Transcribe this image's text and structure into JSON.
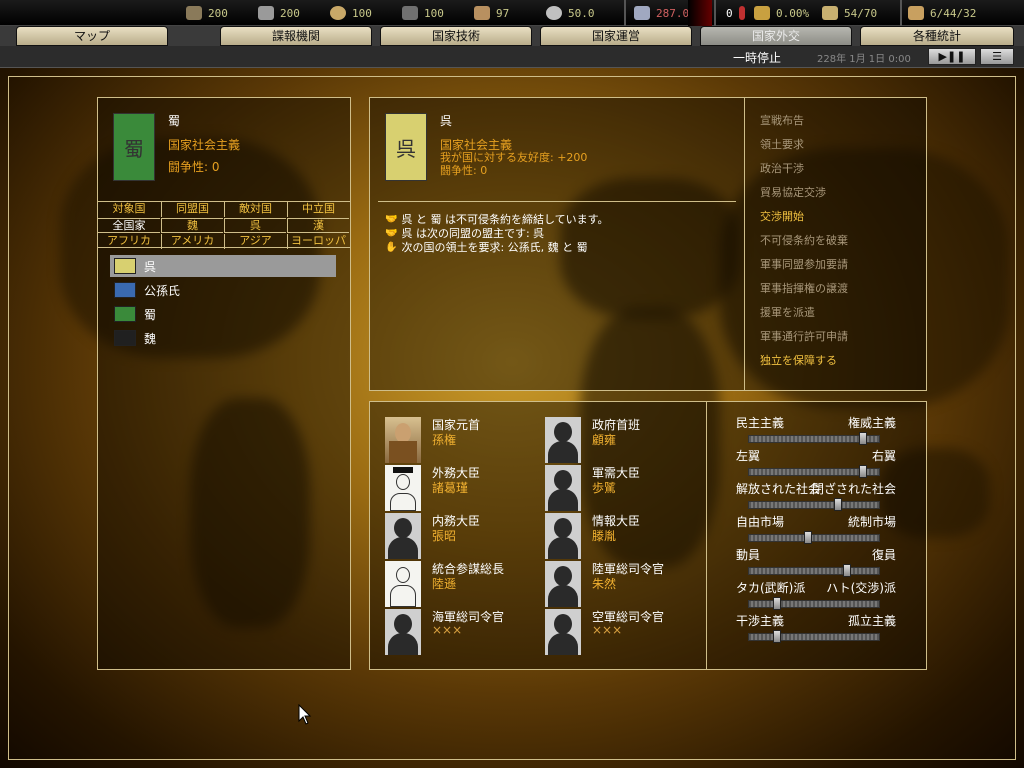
{
  "resources": [
    {
      "icon": "energy-icon",
      "value": "200",
      "color": "#8a7a5a"
    },
    {
      "icon": "metal-icon",
      "value": "200",
      "color": "#9a9a9a"
    },
    {
      "icon": "rare-materials-icon",
      "value": "100",
      "color": "#c8a868"
    },
    {
      "icon": "oil-icon",
      "value": "100",
      "color": "#707070"
    },
    {
      "icon": "supplies-icon",
      "value": "97",
      "color": "#b89060"
    },
    {
      "icon": "money-icon",
      "value": "50.0",
      "color": "#c0c0c0"
    },
    {
      "icon": "manpower-icon",
      "value": "287.0",
      "color": "#a0a8c0"
    },
    {
      "icon": "transport-icon",
      "value": "0",
      "color": "#c03030"
    },
    {
      "icon": "dissent-icon",
      "value": "0.00%",
      "color": "#c8a040"
    },
    {
      "icon": "convoy-icon",
      "value": "54/70",
      "color": "#c8b070"
    },
    {
      "icon": "escort-icon",
      "value": "6/44/32",
      "color": "#c8a060"
    }
  ],
  "tabs": [
    "マップ",
    "諜報機関",
    "国家技術",
    "国家運営",
    "国家外交",
    "各種統計"
  ],
  "status": {
    "pause": "一時停止",
    "date": "228年 1月 1日 0:00"
  },
  "left": {
    "country": "蜀",
    "ideology": "国家社会主義",
    "belligerence": "闘争性: 0",
    "flag_char": "蜀",
    "filter_row1": [
      "対象国",
      "同盟国",
      "敵対国",
      "中立国"
    ],
    "filter_row2": [
      "全国家",
      "魏",
      "呉",
      "漢"
    ],
    "filter_row3": [
      "アフリカ",
      "アメリカ",
      "アジア",
      "ヨーロッパ"
    ],
    "countries": [
      {
        "name": "呉",
        "color": "#d8d070"
      },
      {
        "name": "公孫氏",
        "color": "#3a6ab0"
      },
      {
        "name": "蜀",
        "color": "#3a8a3a"
      },
      {
        "name": "魏",
        "color": "#202020"
      }
    ]
  },
  "target": {
    "country": "呉",
    "ideology": "国家社会主義",
    "relation": "我が国に対する友好度: +200",
    "belligerence": "闘争性: 0",
    "flag_char": "呉",
    "info": [
      "呉 と 蜀 は不可侵条約を締結しています。",
      "呉 は次の同盟の盟主です: 呉",
      "次の国の領土を要求: 公孫氏, 魏 と 蜀"
    ]
  },
  "actions": [
    "宣戦布告",
    "領土要求",
    "政治干渉",
    "貿易協定交渉",
    "交渉開始",
    "不可侵条約を破棄",
    "軍事同盟参加要請",
    "軍事指揮権の譲渡",
    "援軍を派遣",
    "軍事通行許可申請",
    "独立を保障する"
  ],
  "ministers_left": [
    {
      "title": "国家元首",
      "name": "孫権"
    },
    {
      "title": "外務大臣",
      "name": "諸葛瑾"
    },
    {
      "title": "内務大臣",
      "name": "張昭"
    },
    {
      "title": "統合参謀総長",
      "name": "陸遜"
    },
    {
      "title": "海軍総司令官",
      "name": "×××"
    }
  ],
  "ministers_right": [
    {
      "title": "政府首班",
      "name": "顧雍"
    },
    {
      "title": "軍需大臣",
      "name": "歩騭"
    },
    {
      "title": "情報大臣",
      "name": "滕胤"
    },
    {
      "title": "陸軍総司令官",
      "name": "朱然"
    },
    {
      "title": "空軍総司令官",
      "name": "×××"
    }
  ],
  "sliders": [
    {
      "left": "民主主義",
      "right": "権威主義",
      "level": 0.9
    },
    {
      "left": "左翼",
      "right": "右翼",
      "level": 0.9
    },
    {
      "left": "解放された社会",
      "right": "閉ざされた社会",
      "level": 0.7
    },
    {
      "left": "自由市場",
      "right": "統制市場",
      "level": 0.45
    },
    {
      "left": "動員",
      "right": "復員",
      "level": 0.77
    },
    {
      "left": "タカ(武断)派",
      "right": "ハト(交渉)派",
      "level": 0.2
    },
    {
      "left": "干渉主義",
      "right": "孤立主義",
      "level": 0.2
    }
  ]
}
